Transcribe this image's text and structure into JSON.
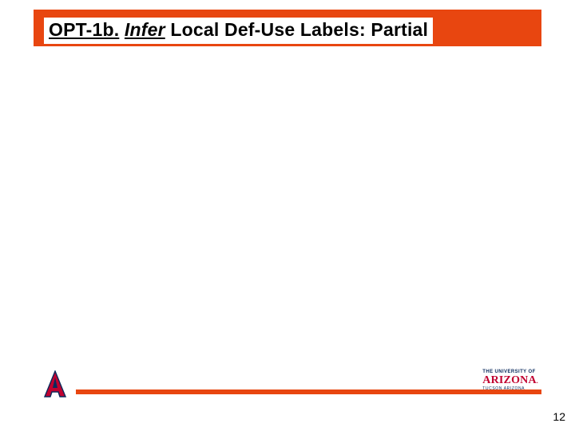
{
  "header": {
    "title_prefix_underlined": "OPT-1b.",
    "title_italic_underlined": "Infer",
    "title_rest": "Local Def-Use Labels: Partial"
  },
  "footer": {
    "wordmark_topline": "THE UNIVERSITY OF",
    "wordmark_main": "ARIZONA",
    "wordmark_sub": "TUCSON ARIZONA"
  },
  "page_number": "12"
}
